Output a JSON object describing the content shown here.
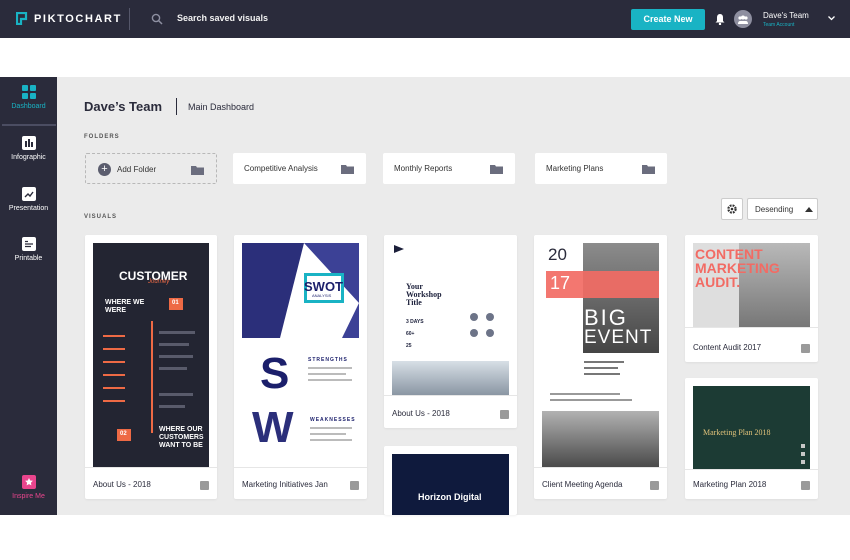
{
  "app": {
    "logo_text": "PIKTOCHART",
    "search_placeholder": "Search saved visuals",
    "create_label": "Create New",
    "team_name": "Dave's Team",
    "team_sub": "Team Account"
  },
  "sidebar": {
    "items": [
      {
        "label": "Dashboard",
        "icon": "dashboard-icon"
      },
      {
        "label": "Infographic",
        "icon": "infographic-icon"
      },
      {
        "label": "Presentation",
        "icon": "presentation-icon"
      },
      {
        "label": "Printable",
        "icon": "printable-icon"
      }
    ],
    "inspire_label": "Inspire Me"
  },
  "header": {
    "title": "Dave’s Team",
    "subtitle": "Main Dashboard"
  },
  "folders": {
    "label": "FOLDERS",
    "add_label": "Add Folder",
    "items": [
      "Competitive Analysis",
      "Monthly Reports",
      "Marketing Plans"
    ]
  },
  "visuals": {
    "label": "VISUALS",
    "sort_label": "Desending",
    "cards": [
      {
        "caption": "About Us - 2018"
      },
      {
        "caption": "Marketing Initiatives Jan"
      },
      {
        "caption": "About Us - 2018"
      },
      {
        "caption": "Client Meeting Agenda"
      },
      {
        "caption": "Content Audit 2017"
      },
      {
        "caption": "Marketing Plan 2018"
      },
      {
        "caption": ""
      }
    ]
  },
  "thumbs": {
    "customer_title": "CUSTOMER",
    "customer_sub": "Journey",
    "where_we_were": "WHERE WE WERE",
    "badge1": "01",
    "badge2": "02",
    "where_customers": "WHERE OUR CUSTOMERS WANT TO BE",
    "swot": "SWOT",
    "swot_sub": "ANALYSIS",
    "s_letter": "S",
    "w_letter": "W",
    "strengths": "STRENGTHS",
    "weaknesses": "WEAKNESSES",
    "workshop_title": "Your Workshop Title",
    "days": "3 DAYS",
    "sixty": "60+",
    "twentyfive": "25",
    "num20": "20",
    "num17": "17",
    "big": "BIG",
    "event": "EVENT",
    "content_audit": "CONTENT MARKETING AUDIT.",
    "marketing_plan": "Marketing Plan 2018",
    "horizon": "Horizon Digital"
  },
  "colors": {
    "dark": "#2a2b3b",
    "teal": "#19b3c4",
    "orange": "#ee6a45",
    "pink": "#e9458d",
    "coral": "#f26b64",
    "navy": "#1b1f6b",
    "green": "#1c3b34"
  }
}
